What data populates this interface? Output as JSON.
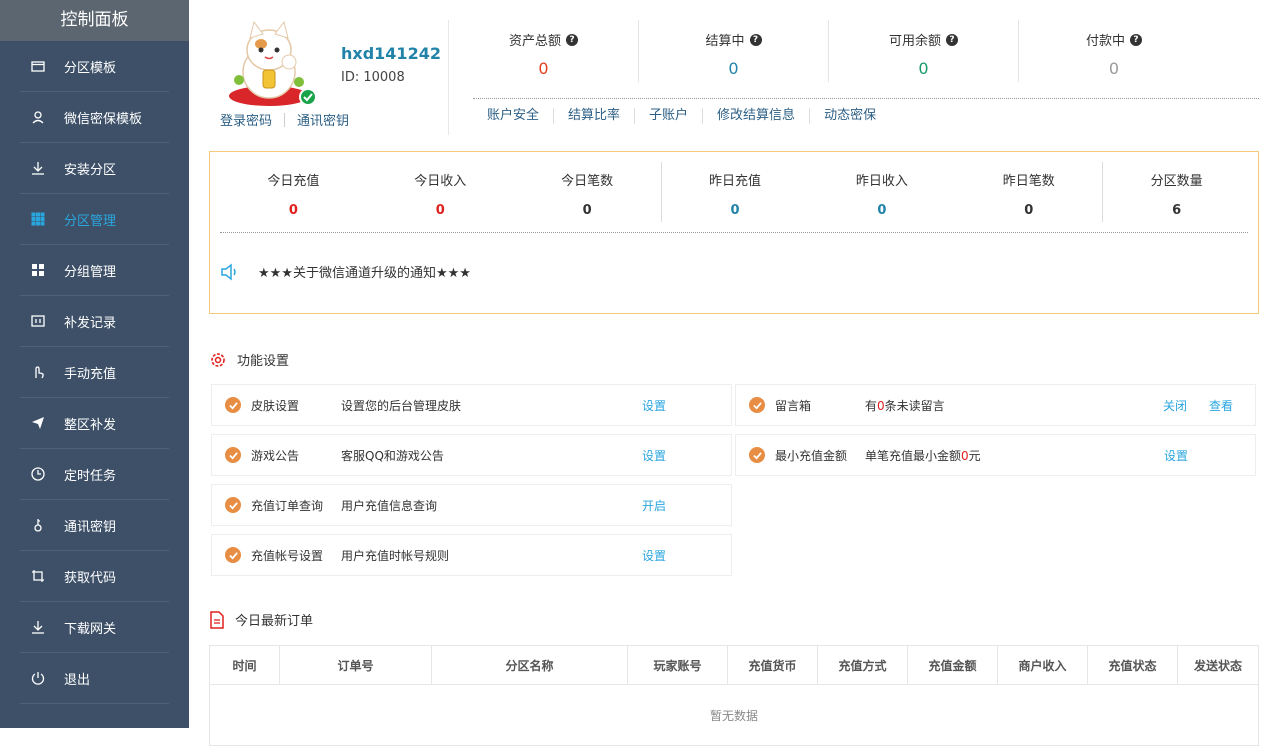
{
  "sidebar": {
    "title": "控制面板",
    "items": [
      {
        "label": "分区模板",
        "icon": "window-icon"
      },
      {
        "label": "微信密保模板",
        "icon": "user-icon"
      },
      {
        "label": "安装分区",
        "icon": "download-icon"
      },
      {
        "label": "分区管理",
        "icon": "grid-icon",
        "active": true
      },
      {
        "label": "分组管理",
        "icon": "squares-icon"
      },
      {
        "label": "补发记录",
        "icon": "record-icon"
      },
      {
        "label": "手动充值",
        "icon": "hand-icon"
      },
      {
        "label": "整区补发",
        "icon": "send-icon"
      },
      {
        "label": "定时任务",
        "icon": "clock-icon"
      },
      {
        "label": "通讯密钥",
        "icon": "key-icon"
      },
      {
        "label": "获取代码",
        "icon": "crop-icon"
      },
      {
        "label": "下载网关",
        "icon": "download-icon"
      },
      {
        "label": "退出",
        "icon": "power-icon"
      }
    ]
  },
  "profile": {
    "username": "hxd141242",
    "id_text": "ID: 10008",
    "links": [
      "登录密码",
      "通讯密钥"
    ]
  },
  "stats": [
    {
      "label": "资产总额",
      "value": "0",
      "color": "#e0401e"
    },
    {
      "label": "结算中",
      "value": "0",
      "color": "#2283a9"
    },
    {
      "label": "可用余额",
      "value": "0",
      "color": "#1b9a6c"
    },
    {
      "label": "付款中",
      "value": "0",
      "color": "#999999"
    }
  ],
  "account_links": [
    "账户安全",
    "结算比率",
    "子账户",
    "修改结算信息",
    "动态密保"
  ],
  "today": {
    "groups": [
      [
        {
          "label": "今日充值",
          "value": "0",
          "color": "#e0201e"
        },
        {
          "label": "今日收入",
          "value": "0",
          "color": "#e0201e"
        },
        {
          "label": "今日笔数",
          "value": "0",
          "color": "#333333"
        }
      ],
      [
        {
          "label": "昨日充值",
          "value": "0",
          "color": "#2283a9"
        },
        {
          "label": "昨日收入",
          "value": "0",
          "color": "#2283a9"
        },
        {
          "label": "昨日笔数",
          "value": "0",
          "color": "#333333"
        }
      ],
      [
        {
          "label": "分区数量",
          "value": "6",
          "color": "#333333"
        }
      ]
    ],
    "notice": "★★★关于微信通道升级的通知★★★"
  },
  "functions": {
    "title": "功能设置",
    "left": [
      {
        "name": "皮肤设置",
        "desc": "设置您的后台管理皮肤",
        "action": "设置"
      },
      {
        "name": "游戏公告",
        "desc": "客服QQ和游戏公告",
        "action": "设置"
      },
      {
        "name": "充值订单查询",
        "desc": "用户充值信息查询",
        "action": "开启"
      },
      {
        "name": "充值帐号设置",
        "desc": "用户充值时帐号规则",
        "action": "设置"
      }
    ],
    "right": [
      {
        "name": "留言箱",
        "desc_pre": "有",
        "desc_num": "0",
        "desc_post": "条未读留言",
        "action_close": "关闭",
        "action": "查看"
      },
      {
        "name": "最小充值金额",
        "desc_pre": "单笔充值最小金额",
        "desc_num": "0",
        "desc_post": "元",
        "action": "设置"
      }
    ]
  },
  "orders": {
    "title": "今日最新订单",
    "columns": [
      "时间",
      "订单号",
      "分区名称",
      "玩家账号",
      "充值货币",
      "充值方式",
      "充值金额",
      "商户收入",
      "充值状态",
      "发送状态"
    ],
    "empty_text": "暂无数据"
  }
}
